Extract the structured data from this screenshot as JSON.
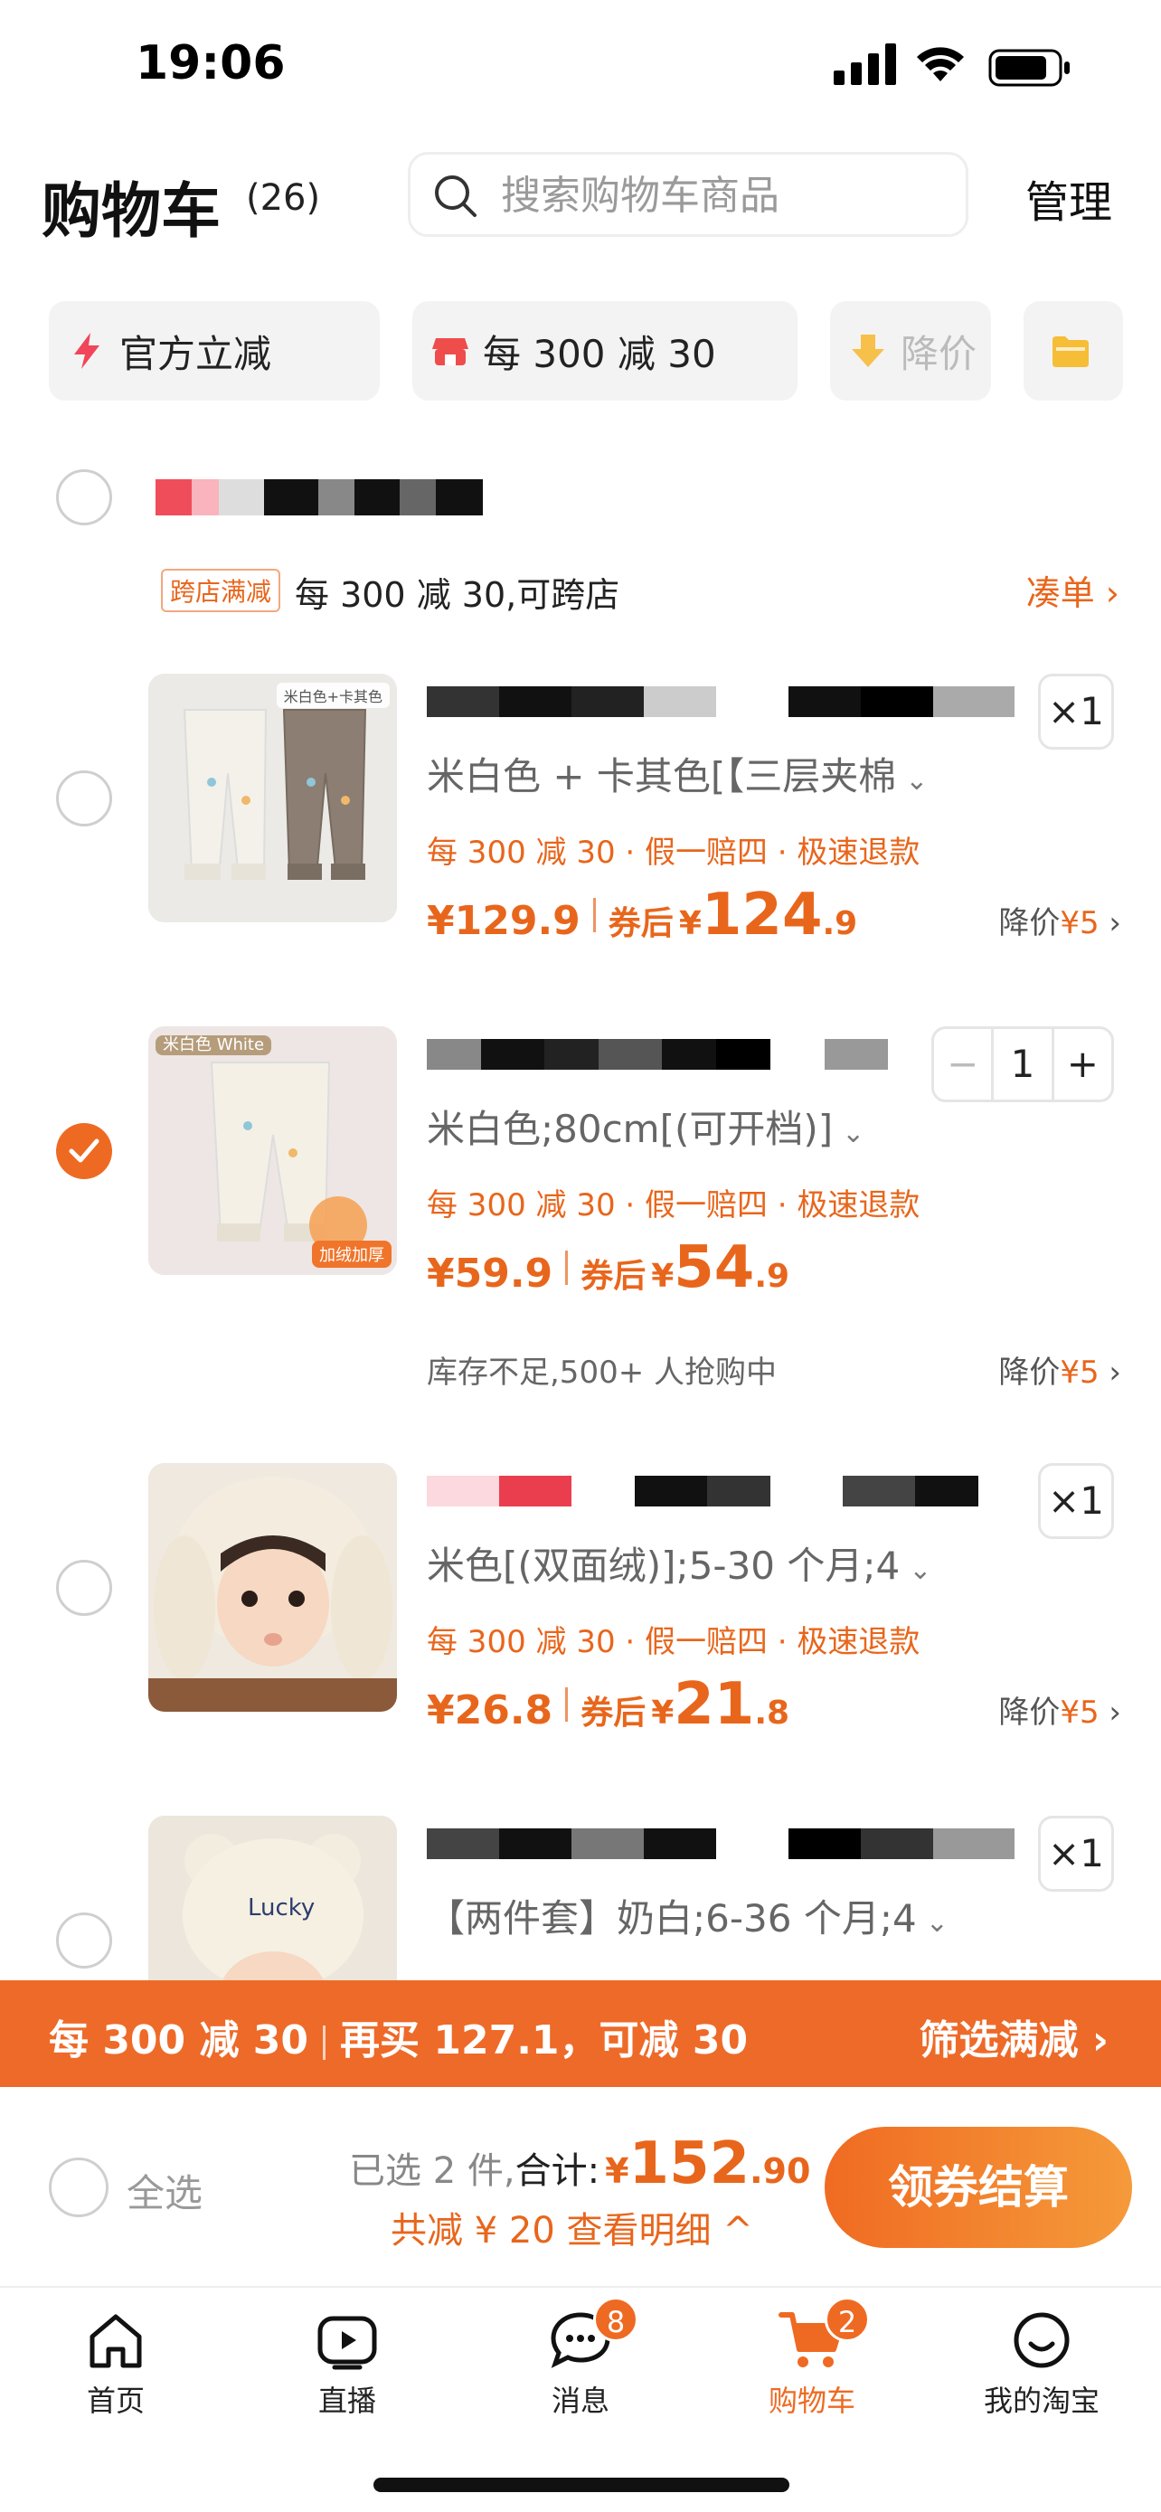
{
  "status_bar": {
    "time": "19:06"
  },
  "header": {
    "title": "购物车",
    "count": "(26)",
    "search_placeholder": "搜索购物车商品",
    "manage_label": "管理"
  },
  "filter_chips": [
    {
      "label": "官方立减",
      "icon": "lightning-icon"
    },
    {
      "label": "每 300 减 30",
      "icon": "shop-icon"
    },
    {
      "label": "降价",
      "icon": "price-drop-icon"
    },
    {
      "label": "",
      "icon": "folder-icon"
    }
  ],
  "store": {
    "promo_tag": "跨店满减",
    "promo_text": "每 300 减 30,可跨店",
    "promo_link": "凑单 ›"
  },
  "items": [
    {
      "thumb_tag": "米白色+卡其色",
      "spec": "米白色 + 卡其色[【三层夹棉",
      "tags": "每 300 减 30 · 假一赔四 · 极速退款",
      "price": "¥129.9",
      "after_label": "券后",
      "after_currency": "¥",
      "after_int": "124",
      "after_dec": ".9",
      "drop_label": "降价",
      "drop_amount": "¥5",
      "quantity": "×1",
      "checked": false
    },
    {
      "thumb_tag": "米白色 White",
      "thumb_badge": "加绒加厚",
      "spec": "米白色;80cm[(可开档)]",
      "tags": "每 300 减 30 · 假一赔四 · 极速退款",
      "price": "¥59.9",
      "after_label": "券后",
      "after_currency": "¥",
      "after_int": "54",
      "after_dec": ".9",
      "stock_note": "库存不足,500+ 人抢购中",
      "drop_label": "降价",
      "drop_amount": "¥5",
      "quantity": "1",
      "checked": true
    },
    {
      "spec": "米色[(双面绒)];5-30 个月;4",
      "tags": "每 300 减 30 · 假一赔四 · 极速退款",
      "price": "¥26.8",
      "after_label": "券后",
      "after_currency": "¥",
      "after_int": "21",
      "after_dec": ".8",
      "drop_label": "降价",
      "drop_amount": "¥5",
      "quantity": "×1",
      "checked": false
    },
    {
      "spec": "【两件套】奶白;6-36 个月;4",
      "quantity": "×1",
      "checked": false
    }
  ],
  "banner": {
    "left_a": "每 300 减 30",
    "left_b": "再买 127.1，可减 30",
    "right": "筛选满减 ›"
  },
  "checkout": {
    "select_all": "全选",
    "selected_text": "已选 2 件,",
    "total_label": "合计:",
    "currency": "¥",
    "total_int": "152",
    "total_dec": ".90",
    "discount_text": "共减 ¥ 20  查看明细 ^",
    "button": "领券结算"
  },
  "tabbar": [
    {
      "label": "首页",
      "icon": "home-icon"
    },
    {
      "label": "直播",
      "icon": "live-icon"
    },
    {
      "label": "消息",
      "icon": "message-icon",
      "badge": "8"
    },
    {
      "label": "购物车",
      "icon": "cart-icon",
      "badge": "2",
      "active": true
    },
    {
      "label": "我的淘宝",
      "icon": "profile-icon"
    }
  ],
  "colors": {
    "accent": "#ee6a22",
    "text": "#111111",
    "muted": "#666666"
  }
}
